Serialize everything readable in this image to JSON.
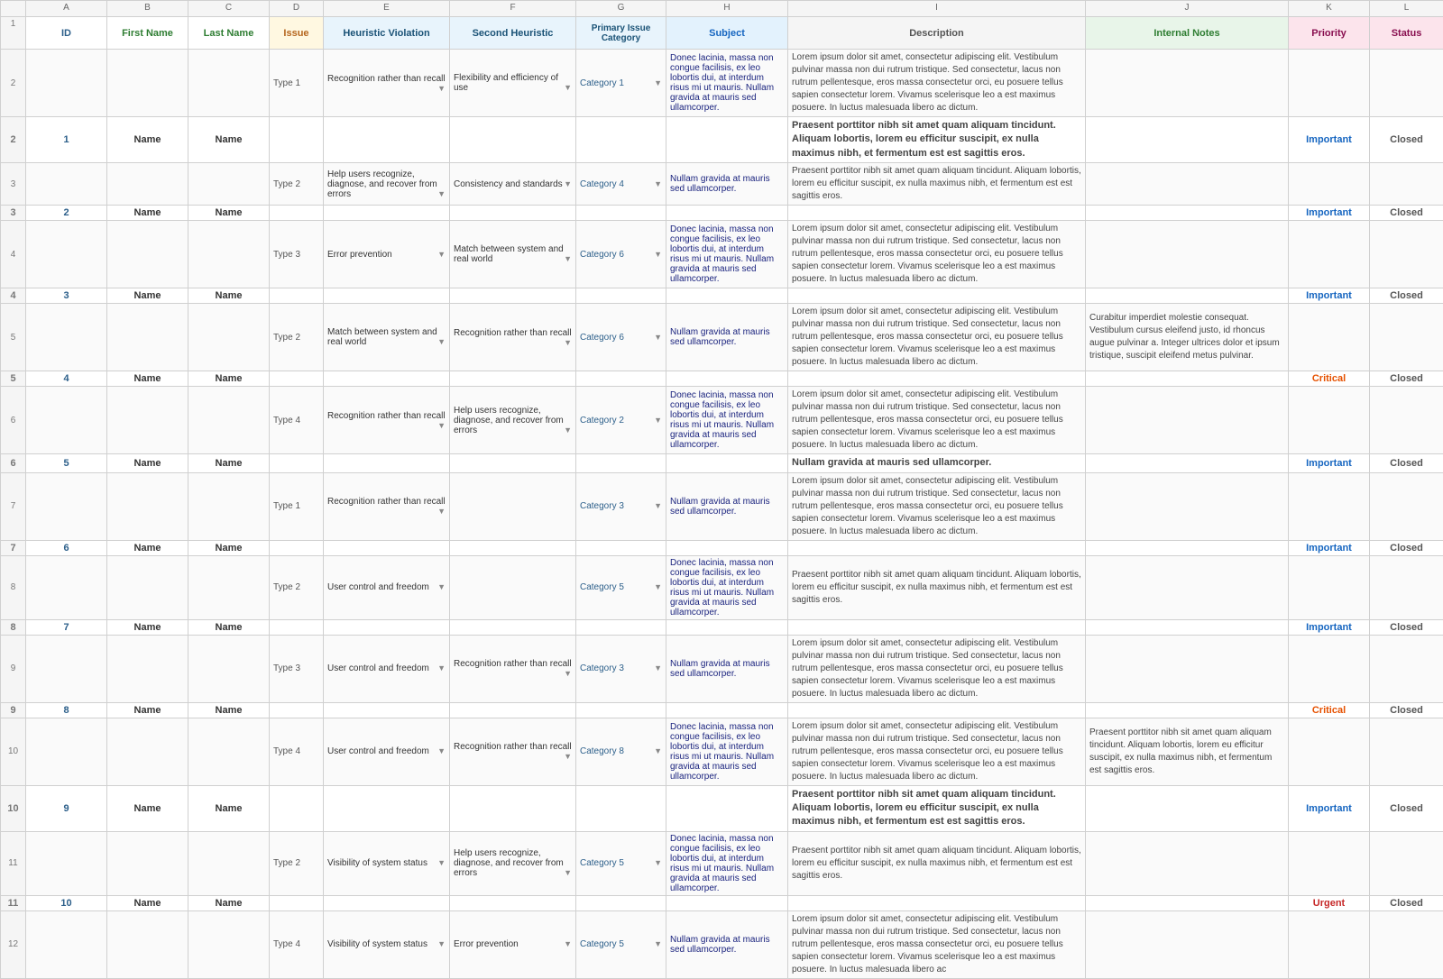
{
  "headers": {
    "col_letters": [
      "",
      "A",
      "B",
      "C",
      "D",
      "E",
      "F",
      "G",
      "H",
      "I",
      "J",
      "K",
      "L"
    ],
    "col_names": {
      "id": "ID",
      "first_name": "First Name",
      "last_name": "Last Name",
      "issue": "Issue",
      "heuristic_violation": "Heuristic Violation",
      "second_heuristic": "Second Heuristic",
      "primary_issue_category": "Primary Issue Category",
      "subject": "Subject",
      "description": "Description",
      "internal_notes": "Internal Notes",
      "priority": "Priority",
      "status": "Status"
    }
  },
  "rows": [
    {
      "row_num": 2,
      "id": "",
      "first_name": "",
      "last_name": "",
      "issue": "Type 1",
      "heuristic_violation": "Recognition rather than recall",
      "second_heuristic": "Flexibility and efficiency of use",
      "primary_issue_category": "Category 1",
      "subject": "Donec lacinia, massa non congue facilisis, ex leo lobortis dui, at interdum risus mi ut mauris. Nullam gravida at mauris sed ullamcorper.",
      "description": "Lorem ipsum dolor sit amet, consectetur adipiscing elit. Vestibulum pulvinar massa non dui rutrum tristique. Sed consectetur, lacus non rutrum pellentesque, eros massa consectetur orci, eu posuere tellus sapien consectetur lorem. Vivamus scelerisque leo a est maximus posuere. In luctus malesuada libero ac dictum.",
      "internal_notes": "",
      "priority": "",
      "status": ""
    },
    {
      "row_num": 2,
      "id": "1",
      "first_name": "Name",
      "last_name": "Name",
      "issue": "",
      "heuristic_violation": "",
      "second_heuristic": "",
      "primary_issue_category": "",
      "subject": "",
      "description": "Praesent porttitor nibh sit amet quam aliquam tincidunt. Aliquam lobortis, lorem eu efficitur suscipit, ex nulla maximus nibh, et fermentum est est sagittis eros.",
      "internal_notes": "",
      "priority": "Important",
      "status": "Closed"
    },
    {
      "row_num": 3,
      "id": "",
      "first_name": "",
      "last_name": "",
      "issue": "Type 2",
      "heuristic_violation": "Help users recognize, diagnose, and recover from errors",
      "second_heuristic": "Consistency and standards",
      "primary_issue_category": "Category 4",
      "subject": "Nullam gravida at mauris sed ullamcorper.",
      "description": "Praesent porttitor nibh sit amet quam aliquam tincidunt. Aliquam lobortis, lorem eu efficitur suscipit, ex nulla maximus nibh, et fermentum est est sagittis eros.",
      "internal_notes": "",
      "priority": "",
      "status": ""
    },
    {
      "row_num": 3,
      "id": "2",
      "first_name": "Name",
      "last_name": "Name",
      "issue": "",
      "heuristic_violation": "",
      "second_heuristic": "",
      "primary_issue_category": "",
      "subject": "",
      "description": "",
      "internal_notes": "",
      "priority": "Important",
      "status": "Closed"
    },
    {
      "row_num": 4,
      "id": "",
      "first_name": "",
      "last_name": "",
      "issue": "Type 3",
      "heuristic_violation": "Error prevention",
      "second_heuristic": "Match between system and real world",
      "primary_issue_category": "Category 6",
      "subject": "Donec lacinia, massa non congue facilisis, ex leo lobortis dui, at interdum risus mi ut mauris. Nullam gravida at mauris sed ullamcorper.",
      "description": "Lorem ipsum dolor sit amet, consectetur adipiscing elit. Vestibulum pulvinar massa non dui rutrum tristique. Sed consectetur, lacus non rutrum pellentesque, eros massa consectetur orci, eu posuere tellus sapien consectetur lorem. Vivamus scelerisque leo a est maximus posuere. In luctus malesuada libero ac dictum.",
      "internal_notes": "",
      "priority": "",
      "status": ""
    },
    {
      "row_num": 4,
      "id": "3",
      "first_name": "Name",
      "last_name": "Name",
      "issue": "",
      "heuristic_violation": "",
      "second_heuristic": "",
      "primary_issue_category": "",
      "subject": "",
      "description": "",
      "internal_notes": "",
      "priority": "Important",
      "status": "Closed"
    },
    {
      "row_num": 5,
      "id": "",
      "first_name": "",
      "last_name": "",
      "issue": "Type 2",
      "heuristic_violation": "Match between system and real world",
      "second_heuristic": "Recognition rather than recall",
      "primary_issue_category": "Category 6",
      "subject": "Nullam gravida at mauris sed ullamcorper.",
      "description": "Lorem ipsum dolor sit amet, consectetur adipiscing elit. Vestibulum pulvinar massa non dui rutrum tristique. Sed consectetur, lacus non rutrum pellentesque, eros massa consectetur orci, eu posuere tellus sapien consectetur lorem. Vivamus scelerisque leo a est maximus posuere. In luctus malesuada libero ac dictum.",
      "internal_notes": "Curabitur imperdiet molestie consequat. Vestibulum cursus eleifend justo, id rhoncus augue pulvinar a. Integer ultrices dolor et ipsum tristique, suscipit eleifend metus pulvinar.",
      "priority": "",
      "status": ""
    },
    {
      "row_num": 5,
      "id": "4",
      "first_name": "Name",
      "last_name": "Name",
      "issue": "",
      "heuristic_violation": "",
      "second_heuristic": "",
      "primary_issue_category": "",
      "subject": "",
      "description": "",
      "internal_notes": "",
      "priority": "Critical",
      "status": "Closed"
    },
    {
      "row_num": 6,
      "id": "",
      "first_name": "",
      "last_name": "",
      "issue": "Type 4",
      "heuristic_violation": "Recognition rather than recall",
      "second_heuristic": "Help users recognize, diagnose, and recover from errors",
      "primary_issue_category": "Category 2",
      "subject": "Donec lacinia, massa non congue facilisis, ex leo lobortis dui, at interdum risus mi ut mauris. Nullam gravida at mauris sed ullamcorper.",
      "description": "Lorem ipsum dolor sit amet, consectetur adipiscing elit. Vestibulum pulvinar massa non dui rutrum tristique. Sed consectetur, lacus non rutrum pellentesque, eros massa consectetur orci, eu posuere tellus sapien consectetur lorem. Vivamus scelerisque leo a est maximus posuere. In luctus malesuada libero ac dictum.",
      "internal_notes": "",
      "priority": "",
      "status": ""
    },
    {
      "row_num": 6,
      "id": "5",
      "first_name": "Name",
      "last_name": "Name",
      "issue": "",
      "heuristic_violation": "",
      "second_heuristic": "",
      "primary_issue_category": "",
      "subject": "",
      "description": "Nullam gravida at mauris sed ullamcorper.",
      "internal_notes": "",
      "priority": "Important",
      "status": "Closed"
    },
    {
      "row_num": 7,
      "id": "",
      "first_name": "",
      "last_name": "",
      "issue": "Type 1",
      "heuristic_violation": "Recognition rather than recall",
      "second_heuristic": "",
      "primary_issue_category": "Category 3",
      "subject": "Nullam gravida at mauris sed ullamcorper.",
      "description": "Lorem ipsum dolor sit amet, consectetur adipiscing elit. Vestibulum pulvinar massa non dui rutrum tristique. Sed consectetur, lacus non rutrum pellentesque, eros massa consectetur orci, eu posuere tellus sapien consectetur lorem. Vivamus scelerisque leo a est maximus posuere. In luctus malesuada libero ac dictum.",
      "internal_notes": "",
      "priority": "",
      "status": ""
    },
    {
      "row_num": 7,
      "id": "6",
      "first_name": "Name",
      "last_name": "Name",
      "issue": "",
      "heuristic_violation": "",
      "second_heuristic": "",
      "primary_issue_category": "",
      "subject": "",
      "description": "",
      "internal_notes": "",
      "priority": "Important",
      "status": "Closed"
    },
    {
      "row_num": 8,
      "id": "",
      "first_name": "",
      "last_name": "",
      "issue": "Type 2",
      "heuristic_violation": "User control and freedom",
      "second_heuristic": "",
      "primary_issue_category": "Category 5",
      "subject": "Donec lacinia, massa non congue facilisis, ex leo lobortis dui, at interdum risus mi ut mauris. Nullam gravida at mauris sed ullamcorper.",
      "description": "Praesent porttitor nibh sit amet quam aliquam tincidunt. Aliquam lobortis, lorem eu efficitur suscipit, ex nulla maximus nibh, et fermentum est est sagittis eros.",
      "internal_notes": "",
      "priority": "",
      "status": ""
    },
    {
      "row_num": 8,
      "id": "7",
      "first_name": "Name",
      "last_name": "Name",
      "issue": "",
      "heuristic_violation": "",
      "second_heuristic": "",
      "primary_issue_category": "",
      "subject": "",
      "description": "",
      "internal_notes": "",
      "priority": "Important",
      "status": "Closed"
    },
    {
      "row_num": 9,
      "id": "",
      "first_name": "",
      "last_name": "",
      "issue": "Type 3",
      "heuristic_violation": "User control and freedom",
      "second_heuristic": "Recognition rather than recall",
      "primary_issue_category": "Category 3",
      "subject": "Nullam gravida at mauris sed ullamcorper.",
      "description": "Lorem ipsum dolor sit amet, consectetur adipiscing elit. Vestibulum pulvinar massa non dui rutrum tristique. Sed consectetur, lacus non rutrum pellentesque, eros massa consectetur orci, eu posuere tellus sapien consectetur lorem. Vivamus scelerisque leo a est maximus posuere. In luctus malesuada libero ac dictum.",
      "internal_notes": "",
      "priority": "",
      "status": ""
    },
    {
      "row_num": 9,
      "id": "8",
      "first_name": "Name",
      "last_name": "Name",
      "issue": "",
      "heuristic_violation": "",
      "second_heuristic": "",
      "primary_issue_category": "",
      "subject": "",
      "description": "",
      "internal_notes": "",
      "priority": "Critical",
      "status": "Closed"
    },
    {
      "row_num": 10,
      "id": "",
      "first_name": "",
      "last_name": "",
      "issue": "Type 4",
      "heuristic_violation": "User control and freedom",
      "second_heuristic": "Recognition rather than recall",
      "primary_issue_category": "Category 8",
      "subject": "Donec lacinia, massa non congue facilisis, ex leo lobortis dui, at interdum risus mi ut mauris. Nullam gravida at mauris sed ullamcorper.",
      "description": "Lorem ipsum dolor sit amet, consectetur adipiscing elit. Vestibulum pulvinar massa non dui rutrum tristique. Sed consectetur, lacus non rutrum pellentesque, eros massa consectetur orci, eu posuere tellus sapien consectetur lorem. Vivamus scelerisque leo a est maximus posuere. In luctus malesuada libero ac dictum.",
      "internal_notes": "Praesent porttitor nibh sit amet quam aliquam tincidunt. Aliquam lobortis, lorem eu efficitur suscipit, ex nulla maximus nibh, et fermentum est sagittis eros.",
      "priority": "",
      "status": ""
    },
    {
      "row_num": 10,
      "id": "9",
      "first_name": "Name",
      "last_name": "Name",
      "issue": "",
      "heuristic_violation": "",
      "second_heuristic": "",
      "primary_issue_category": "",
      "subject": "",
      "description": "Praesent porttitor nibh sit amet quam aliquam tincidunt. Aliquam lobortis, lorem eu efficitur suscipit, ex nulla maximus nibh, et fermentum est est sagittis eros.",
      "internal_notes": "",
      "priority": "Important",
      "status": "Closed"
    },
    {
      "row_num": 11,
      "id": "",
      "first_name": "",
      "last_name": "",
      "issue": "Type 2",
      "heuristic_violation": "Visibility of system status",
      "second_heuristic": "Help users recognize, diagnose, and recover from errors",
      "primary_issue_category": "Category 5",
      "subject": "Donec lacinia, massa non congue facilisis, ex leo lobortis dui, at interdum risus mi ut mauris. Nullam gravida at mauris sed ullamcorper.",
      "description": "Praesent porttitor nibh sit amet quam aliquam tincidunt. Aliquam lobortis, lorem eu efficitur suscipit, ex nulla maximus nibh, et fermentum est est sagittis eros.",
      "internal_notes": "",
      "priority": "",
      "status": ""
    },
    {
      "row_num": 11,
      "id": "10",
      "first_name": "Name",
      "last_name": "Name",
      "issue": "",
      "heuristic_violation": "",
      "second_heuristic": "",
      "primary_issue_category": "",
      "subject": "",
      "description": "",
      "internal_notes": "",
      "priority": "Urgent",
      "status": "Closed"
    },
    {
      "row_num": 12,
      "id": "",
      "first_name": "",
      "last_name": "",
      "issue": "Type 4",
      "heuristic_violation": "Visibility of system status",
      "second_heuristic": "Error prevention",
      "primary_issue_category": "Category 5",
      "subject": "Nullam gravida at mauris sed ullamcorper.",
      "description": "Lorem ipsum dolor sit amet, consectetur adipiscing elit. Vestibulum pulvinar massa non dui rutrum tristique. Sed consectetur, lacus non rutrum pellentesque, eros massa consectetur orci, eu posuere tellus sapien consectetur lorem. Vivamus scelerisque leo a est maximus posuere. In luctus malesuada libero ac",
      "internal_notes": "",
      "priority": "",
      "status": ""
    }
  ]
}
